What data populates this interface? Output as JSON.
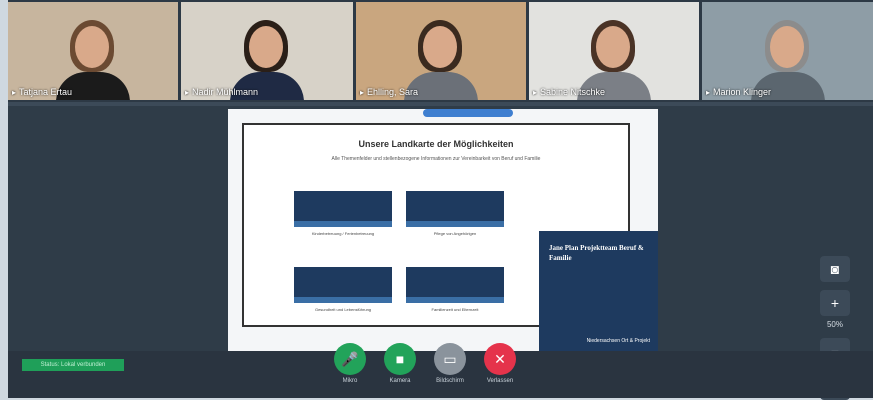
{
  "participants": [
    {
      "name": "Tatjana Ertau",
      "bg": "#c7b59e",
      "hair": "#6b4a32",
      "shirt": "#1b1b1b"
    },
    {
      "name": "Nadir Mühlmann",
      "bg": "#d7d2c8",
      "hair": "#2a1f18",
      "shirt": "#1f2a44"
    },
    {
      "name": "Ehlling, Sara",
      "bg": "#c9a67f",
      "hair": "#3a2a1f",
      "shirt": "#6b7078"
    },
    {
      "name": "Sabine Nitschke",
      "bg": "#e2e2df",
      "hair": "#4a3326",
      "shirt": "#7b7f86"
    },
    {
      "name": "Marion Klinger",
      "bg": "#8e9da6",
      "hair": "#8c8c8c",
      "shirt": "#5b666f"
    }
  ],
  "slide": {
    "title": "Unsere Landkarte der Möglichkeiten",
    "subtitle": "Alle Themenfelder und stellenbezogene Informationen zur Vereinbarkeit von Beruf und Familie",
    "thumbs": [
      {
        "caption": "Kinderbetreuung / Ferienbetreuung"
      },
      {
        "caption": "Pflege von Angehörigen"
      },
      {
        "caption": "Gesundheit und Lebensführung"
      },
      {
        "caption": "Familienzeit und Elternzeit"
      }
    ],
    "panel_title": "Jane Plan Projektteam Beruf & Familie",
    "panel_footer": "Niedersachsen Ort & Projekt"
  },
  "side_controls": {
    "camera_icon": "camera-icon",
    "zoom_in": "+",
    "zoom_level": "50%",
    "zoom_out": "−",
    "popout_icon": "external-link-icon"
  },
  "bottom": {
    "status": "Status: Lokal verbunden",
    "controls": [
      {
        "label": "Mikro",
        "color": "#22a35a",
        "icon": "microphone-icon",
        "glyph": "🎤"
      },
      {
        "label": "Kamera",
        "color": "#22a35a",
        "icon": "video-camera-icon",
        "glyph": "■"
      },
      {
        "label": "Bildschirm",
        "color": "#8a939c",
        "icon": "screen-share-icon",
        "glyph": "▭"
      },
      {
        "label": "Verlassen",
        "color": "#e5334b",
        "icon": "close-icon",
        "glyph": "✕"
      }
    ]
  }
}
